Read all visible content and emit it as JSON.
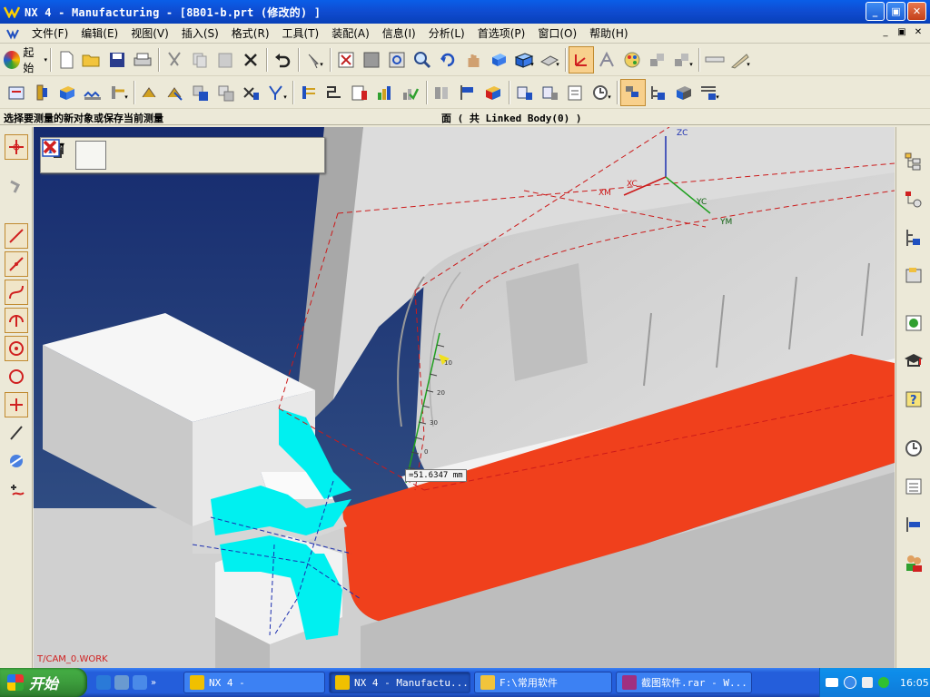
{
  "window": {
    "title": "NX 4 - Manufacturing - [8B01-b.prt  (修改的) ]",
    "minimize": "_",
    "maximize": "▣",
    "close": "✕"
  },
  "menu": {
    "items": [
      "文件(F)",
      "编辑(E)",
      "视图(V)",
      "插入(S)",
      "格式(R)",
      "工具(T)",
      "装配(A)",
      "信息(I)",
      "分析(L)",
      "首选项(P)",
      "窗口(O)",
      "帮助(H)"
    ],
    "mdi": [
      "_",
      "▣",
      "✕"
    ]
  },
  "toolbar": {
    "start_label": "起始",
    "row1_icons": [
      "new-file-icon",
      "open-folder-icon",
      "save-icon",
      "print-icon",
      "cut-icon",
      "copy-icon",
      "paste-icon",
      "delete-icon",
      "undo-icon",
      "command-finder-icon",
      "fit-icon",
      "zoom-window-icon",
      "zoom-region-icon",
      "zoom-icon",
      "rotate-icon",
      "pan-icon",
      "shaded-icon",
      "shaded-edges-icon",
      "wireframe-icon",
      "wcs-icon",
      "assembly-icon",
      "color-palette-icon",
      "layer-icon",
      "layer-settings-icon",
      "measure-icon",
      "ruler-icon"
    ],
    "row2_icons": [
      "create-program-icon",
      "create-tool-icon",
      "create-geometry-icon",
      "create-method-icon",
      "create-operation-icon",
      "edit-object-icon",
      "cut-object-icon",
      "copy-object-icon",
      "paste-object-icon",
      "delete-object-icon",
      "display-object-icon",
      "generate-path-icon",
      "replay-path-icon",
      "list-path-icon",
      "verify-path-icon",
      "post-process-icon",
      "shop-doc-icon",
      "output-cls-icon",
      "program-order-view-icon",
      "machine-tool-view-icon",
      "geometry-view-icon",
      "method-view-icon",
      "clock-icon",
      "info-view-icon",
      "operation-nav-icon",
      "tool-nav-icon",
      "program-nav-icon"
    ]
  },
  "status": {
    "prompt": "选择要测量的新对象或保存当前测量",
    "selection": "面 ( 共  Linked Body(0) )"
  },
  "viewport": {
    "measure_value": "=51.6347 mm",
    "wcs_text": "T/CAM_0.WORK",
    "axes": {
      "zc": "ZC",
      "xc": "XC",
      "yc": "YC",
      "xm": "XM",
      "ym": "YM"
    },
    "ruler_ticks": [
      "10",
      "20",
      "30",
      "0"
    ],
    "floatbar_icons": [
      "measure-distance-icon",
      "measure-projected-icon",
      "measure-screen-icon",
      "measure-length-icon",
      "p1-p2-save-icon",
      "measure-radius-icon",
      "info-icon",
      "close-icon"
    ],
    "colors": {
      "background": "#1d2f6a",
      "part": "#d9d9d9",
      "highlight_red": "#f0401c",
      "cyan": "#00f0f0"
    }
  },
  "leftbar": {
    "icons": [
      "select-point-icon",
      "select-filter-icon",
      "line-icon",
      "line-tangent-icon",
      "curve-icon",
      "arc-icon",
      "circle-center-icon",
      "circle-icon",
      "point-icon",
      "tangent-line-icon",
      "sphere-icon",
      "snap-icon"
    ]
  },
  "rightbar": {
    "icons": [
      "assembly-navigator-icon",
      "part-navigator-icon",
      "operation-navigator-icon",
      "reuse-library-icon",
      "web-browser-icon",
      "training-icon",
      "help-icon",
      "history-icon",
      "system-materials-icon",
      "process-studio-icon",
      "roles-icon"
    ]
  },
  "taskbar": {
    "start_label": "开始",
    "tasks": [
      {
        "label": "NX 4 -",
        "active": false
      },
      {
        "label": "NX 4 - Manufactu...",
        "active": true
      },
      {
        "label": "F:\\常用软件",
        "active": false
      },
      {
        "label": "截图软件.rar - W...",
        "active": false
      }
    ],
    "clock": "16:05"
  }
}
